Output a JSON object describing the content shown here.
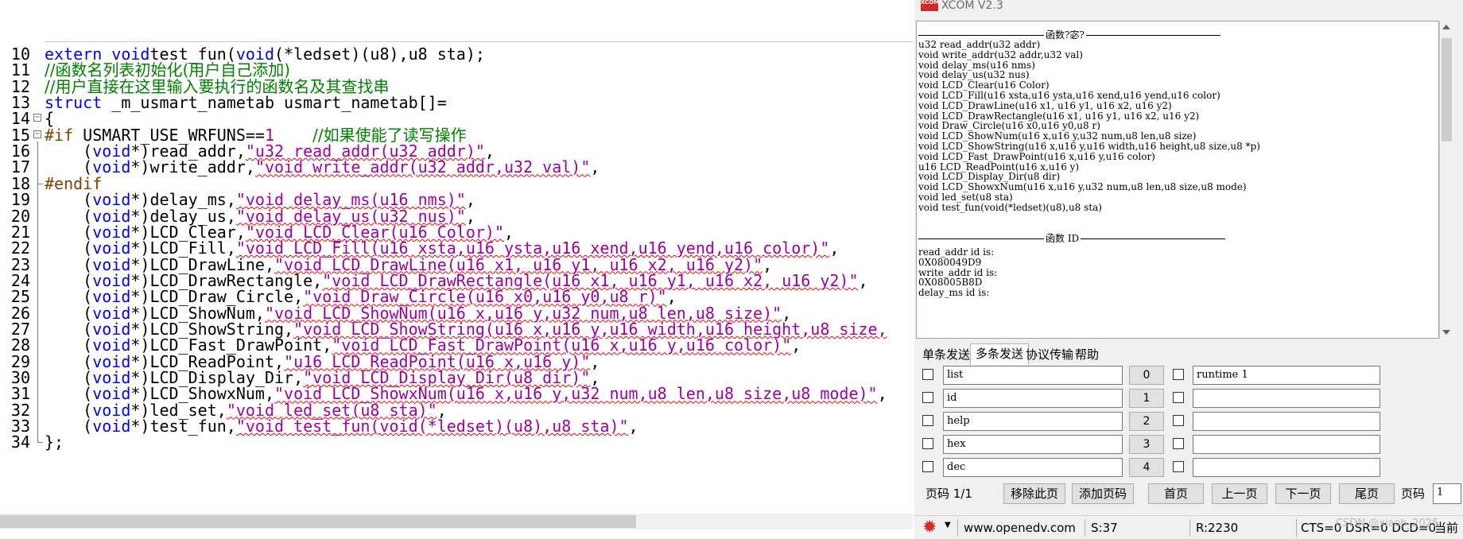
{
  "editor": {
    "lines": [
      {
        "n": "10",
        "fold": "none",
        "segs": [
          [
            "kw",
            "extern "
          ],
          [
            "kw",
            "void"
          ],
          [
            "",
            "test_fun("
          ],
          [
            "kw",
            "void"
          ],
          [
            "",
            "(*ledset)(u8),u8 sta);"
          ]
        ]
      },
      {
        "n": "11",
        "fold": "none",
        "segs": [
          [
            "cm",
            "//函数名列表初始化(用户自己添加)"
          ]
        ]
      },
      {
        "n": "12",
        "fold": "none",
        "segs": [
          [
            "cm",
            "//用户直接在这里输入要执行的函数名及其查找串"
          ]
        ]
      },
      {
        "n": "13",
        "fold": "none",
        "segs": [
          [
            "kw",
            "struct "
          ],
          [
            "",
            "_m_usmart_nametab usmart_nametab[]="
          ]
        ]
      },
      {
        "n": "14",
        "fold": "box",
        "segs": [
          [
            "",
            "{"
          ]
        ]
      },
      {
        "n": "15",
        "fold": "box",
        "segs": [
          [
            "pp",
            "#if "
          ],
          [
            "",
            "USMART_USE_WRFUNS=="
          ],
          [
            "st",
            "1"
          ],
          [
            "",
            "    "
          ],
          [
            "cm",
            "//如果使能了读写操作"
          ]
        ]
      },
      {
        "n": "16",
        "fold": "line",
        "segs": [
          [
            "",
            "    ("
          ],
          [
            "kw",
            "void"
          ],
          [
            "",
            "*)read_addr,"
          ],
          [
            "st sq",
            "\"u32 read_addr(u32 addr)\""
          ],
          [
            "",
            ","
          ]
        ]
      },
      {
        "n": "17",
        "fold": "line",
        "segs": [
          [
            "",
            "    ("
          ],
          [
            "kw",
            "void"
          ],
          [
            "",
            "*)write_addr,"
          ],
          [
            "st sq",
            "\"void write_addr(u32 addr,u32 val)\""
          ],
          [
            "",
            ","
          ]
        ]
      },
      {
        "n": "18",
        "fold": "end",
        "segs": [
          [
            "pp",
            "#endif"
          ]
        ]
      },
      {
        "n": "19",
        "fold": "line",
        "segs": [
          [
            "",
            "    ("
          ],
          [
            "kw",
            "void"
          ],
          [
            "",
            "*)delay_ms,"
          ],
          [
            "st sq",
            "\"void delay_ms(u16 nms)\""
          ],
          [
            "",
            ","
          ]
        ]
      },
      {
        "n": "20",
        "fold": "line",
        "segs": [
          [
            "",
            "    ("
          ],
          [
            "kw",
            "void"
          ],
          [
            "",
            "*)delay_us,"
          ],
          [
            "st sq",
            "\"void delay_us(u32 nus)\""
          ],
          [
            "",
            ","
          ]
        ]
      },
      {
        "n": "21",
        "fold": "line",
        "segs": [
          [
            "",
            "    ("
          ],
          [
            "kw",
            "void"
          ],
          [
            "",
            "*)LCD_Clear,"
          ],
          [
            "st sq",
            "\"void LCD_Clear(u16 Color)\""
          ],
          [
            "",
            ","
          ]
        ]
      },
      {
        "n": "22",
        "fold": "line",
        "segs": [
          [
            "",
            "    ("
          ],
          [
            "kw",
            "void"
          ],
          [
            "",
            "*)LCD_Fill,"
          ],
          [
            "st sq",
            "\"void LCD_Fill(u16 xsta,u16 ysta,u16 xend,u16 yend,u16 color)\""
          ],
          [
            "",
            ","
          ]
        ]
      },
      {
        "n": "23",
        "fold": "line",
        "segs": [
          [
            "",
            "    ("
          ],
          [
            "kw",
            "void"
          ],
          [
            "",
            "*)LCD_DrawLine,"
          ],
          [
            "st sq",
            "\"void LCD_DrawLine(u16 x1, u16 y1, u16 x2, u16 y2)\""
          ],
          [
            "",
            ","
          ]
        ]
      },
      {
        "n": "24",
        "fold": "line",
        "segs": [
          [
            "",
            "    ("
          ],
          [
            "kw",
            "void"
          ],
          [
            "",
            "*)LCD_DrawRectangle,"
          ],
          [
            "st sq",
            "\"void LCD_DrawRectangle(u16 x1, u16 y1, u16 x2, u16 y2)\""
          ],
          [
            "",
            ","
          ]
        ]
      },
      {
        "n": "25",
        "fold": "line",
        "segs": [
          [
            "",
            "    ("
          ],
          [
            "kw",
            "void"
          ],
          [
            "",
            "*)LCD_Draw_Circle,"
          ],
          [
            "st sq",
            "\"void Draw_Circle(u16 x0,u16 y0,u8 r)\""
          ],
          [
            "",
            ","
          ]
        ]
      },
      {
        "n": "26",
        "fold": "line",
        "segs": [
          [
            "",
            "    ("
          ],
          [
            "kw",
            "void"
          ],
          [
            "",
            "*)LCD_ShowNum,"
          ],
          [
            "st sq",
            "\"void LCD_ShowNum(u16 x,u16 y,u32 num,u8 len,u8 size)\""
          ],
          [
            "",
            ","
          ]
        ]
      },
      {
        "n": "27",
        "fold": "line",
        "segs": [
          [
            "",
            "    ("
          ],
          [
            "kw",
            "void"
          ],
          [
            "",
            "*)LCD_ShowString,"
          ],
          [
            "st sq",
            "\"void LCD_ShowString(u16 x,u16 y,u16 width,u16 height,u8 size,"
          ]
        ]
      },
      {
        "n": "28",
        "fold": "line",
        "segs": [
          [
            "",
            "    ("
          ],
          [
            "kw",
            "void"
          ],
          [
            "",
            "*)LCD_Fast_DrawPoint,"
          ],
          [
            "st sq",
            "\"void LCD_Fast_DrawPoint(u16 x,u16 y,u16 color)\""
          ],
          [
            "",
            ","
          ]
        ]
      },
      {
        "n": "29",
        "fold": "line",
        "segs": [
          [
            "",
            "    ("
          ],
          [
            "kw",
            "void"
          ],
          [
            "",
            "*)LCD_ReadPoint,"
          ],
          [
            "st sq",
            "\"u16 LCD_ReadPoint(u16 x,u16 y)\""
          ],
          [
            "",
            ","
          ]
        ]
      },
      {
        "n": "30",
        "fold": "line",
        "segs": [
          [
            "",
            "    ("
          ],
          [
            "kw",
            "void"
          ],
          [
            "",
            "*)LCD_Display_Dir,"
          ],
          [
            "st sq",
            "\"void LCD_Display_Dir(u8 dir)\""
          ],
          [
            "",
            ","
          ]
        ]
      },
      {
        "n": "31",
        "fold": "line",
        "segs": [
          [
            "",
            "    ("
          ],
          [
            "kw",
            "void"
          ],
          [
            "",
            "*)LCD_ShowxNum,"
          ],
          [
            "st sq",
            "\"void LCD_ShowxNum(u16 x,u16 y,u32 num,u8 len,u8 size,u8 mode)\""
          ],
          [
            "",
            ","
          ]
        ]
      },
      {
        "n": "32",
        "fold": "line",
        "segs": [
          [
            "",
            "    ("
          ],
          [
            "kw",
            "void"
          ],
          [
            "",
            "*)led_set,"
          ],
          [
            "st sq",
            "\"void led_set(u8 sta)\""
          ],
          [
            "",
            ","
          ]
        ]
      },
      {
        "n": "33",
        "fold": "line",
        "segs": [
          [
            "",
            "    ("
          ],
          [
            "kw",
            "void"
          ],
          [
            "",
            "*)test_fun,"
          ],
          [
            "st sq",
            "\"void test_fun(void(*ledset)(u8),u8 sta)\""
          ],
          [
            "",
            ","
          ]
        ]
      },
      {
        "n": "34",
        "fold": "close",
        "segs": [
          [
            "",
            "};"
          ]
        ]
      }
    ]
  },
  "xcom": {
    "title": "XCOM V2.3",
    "logo": "XCOM",
    "receive": {
      "section1_label": "函数?宓?",
      "functions": [
        "u32 read_addr(u32 addr)",
        "void write_addr(u32 addr,u32 val)",
        "void delay_ms(u16 nms)",
        "void delay_us(u32 nus)",
        "void LCD_Clear(u16 Color)",
        "void LCD_Fill(u16 xsta,u16 ysta,u16 xend,u16 yend,u16 color)",
        "void LCD_DrawLine(u16 x1, u16 y1, u16 x2, u16 y2)",
        "void LCD_DrawRectangle(u16 x1, u16 y1, u16 x2, u16 y2)",
        "void Draw_Circle(u16 x0,u16 y0,u8 r)",
        "void LCD_ShowNum(u16 x,u16 y,u32 num,u8 len,u8 size)",
        "void LCD_ShowString(u16 x,u16 y,u16 width,u16 height,u8 size,u8 *p)",
        "void LCD_Fast_DrawPoint(u16 x,u16 y,u16 color)",
        "u16 LCD_ReadPoint(u16 x,u16 y)",
        "void LCD_Display_Dir(u8 dir)",
        "void LCD_ShowxNum(u16 x,u16 y,u32 num,u8 len,u8 size,u8 mode)",
        "void led_set(u8 sta)",
        "void test_fun(void(*ledset)(u8),u8 sta)"
      ],
      "section2_label": "函数 ID",
      "ids": [
        "read_addr id is:",
        "0X080049D9",
        "write_addr id is:",
        "0X08005B8D",
        "delay_ms id is:"
      ]
    },
    "tabs": [
      "单条发送",
      "多条发送",
      "协议传输",
      "帮助"
    ],
    "active_tab": 1,
    "multi_send": {
      "left": [
        {
          "text": "list",
          "num": "0"
        },
        {
          "text": "id",
          "num": "1"
        },
        {
          "text": "help",
          "num": "2"
        },
        {
          "text": "hex",
          "num": "3"
        },
        {
          "text": "dec",
          "num": "4"
        }
      ],
      "right": [
        "runtime 1",
        "",
        "",
        "",
        ""
      ]
    },
    "pager": {
      "page_info": "页码 1/1",
      "remove": "移除此页",
      "add": "添加页码",
      "first": "首页",
      "prev": "上一页",
      "next": "下一页",
      "last": "尾页",
      "page_label": "页码",
      "page_value": "1"
    },
    "status": {
      "site": "www.openedv.com",
      "sent": "S:37",
      "received": "R:2230",
      "signals": "CTS=0 DSR=0 DCD=0",
      "current": "当前",
      "watermark": "CSDN @xiaoh_2025"
    },
    "colors": {
      "keyword": "#0000ff",
      "comment": "#008000",
      "string": "#a000a0",
      "preprocessor": "#804000",
      "logo": "#d12c2c"
    }
  }
}
